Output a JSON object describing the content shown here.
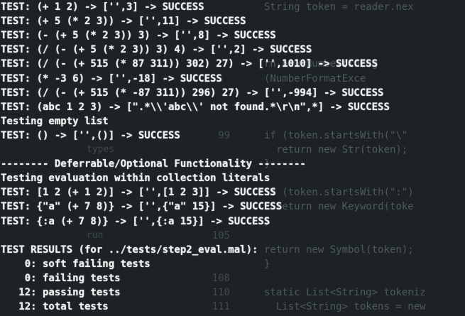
{
  "terminal": {
    "lines": [
      "TEST: (+ 1 2) -> ['',3] -> SUCCESS",
      "TEST: (+ 5 (* 2 3)) -> ['',11] -> SUCCESS",
      "TEST: (- (+ 5 (* 2 3)) 3) -> ['',8] -> SUCCESS",
      "TEST: (/ (- (+ 5 (* 2 3)) 3) 4) -> ['',2] -> SUCCESS",
      "TEST: (/ (- (+ 515 (* 87 311)) 302) 27) -> ['',1010] -> SUCCESS",
      "TEST: (* -3 6) -> ['',-18] -> SUCCESS",
      "TEST: (/ (- (+ 515 (* -87 311)) 296) 27) -> ['',-994] -> SUCCESS",
      "TEST: (abc 1 2 3) -> [\".*\\\\'abc\\\\' not found.*\\r\\n\",*] -> SUCCESS",
      "Testing empty list",
      "TEST: () -> ['',()] -> SUCCESS",
      "",
      "-------- Deferrable/Optional Functionality --------",
      "Testing evaluation within collection literals",
      "TEST: [1 2 (+ 1 2)] -> ['',[1 2 3]] -> SUCCESS",
      "TEST: {\"a\" (+ 7 8)} -> ['',{\"a\" 15}] -> SUCCESS",
      "TEST: {:a (+ 7 8)} -> ['',{:a 15}] -> SUCCESS",
      "",
      "TEST RESULTS (for ../tests/step2_eval.mal):",
      "    0: soft failing tests",
      "    0: failing tests",
      "   12: passing tests",
      "   12: total tests"
    ]
  },
  "background_editor": {
    "lines": [
      {
        "num": "",
        "code": "String token = reader.nex",
        "side": ""
      },
      {
        "num": "",
        "code": "",
        "side": ""
      },
      {
        "num": "",
        "code": "",
        "side": ""
      },
      {
        "num": "",
        "code": "",
        "side": ""
      },
      {
        "num": "",
        "code": "rn new Number(Integ",
        "side": ""
      },
      {
        "num": "",
        "code": "(NumberFormatExce",
        "side": ""
      },
      {
        "num": "",
        "code": "",
        "side": ""
      },
      {
        "num": "",
        "code": "",
        "side": ""
      },
      {
        "num": "",
        "code": "",
        "side": "mod"
      },
      {
        "num": "99",
        "code": "if (token.startsWith(\"\\\"",
        "side": ""
      },
      {
        "num": "",
        "code": "  return new Str(token);",
        "side": "types"
      },
      {
        "num": "",
        "code": "}",
        "side": ""
      },
      {
        "num": "",
        "code": "",
        "side": ""
      },
      {
        "num": "",
        "code": "if (token.startsWith(\":\")",
        "side": ""
      },
      {
        "num": "",
        "code": "  return new Keyword(toke",
        "side": ""
      },
      {
        "num": "",
        "code": "}",
        "side": ""
      },
      {
        "num": "105",
        "code": "",
        "side": "run"
      },
      {
        "num": "",
        "code": "return new Symbol(token);",
        "side": ""
      },
      {
        "num": "",
        "code": "}",
        "side": ""
      },
      {
        "num": "108",
        "code": "",
        "side": ""
      },
      {
        "num": "110",
        "code": "static List<String> tokeniz",
        "side": ""
      },
      {
        "num": "111",
        "code": "  List<String> tokens = new",
        "side": ""
      }
    ]
  }
}
